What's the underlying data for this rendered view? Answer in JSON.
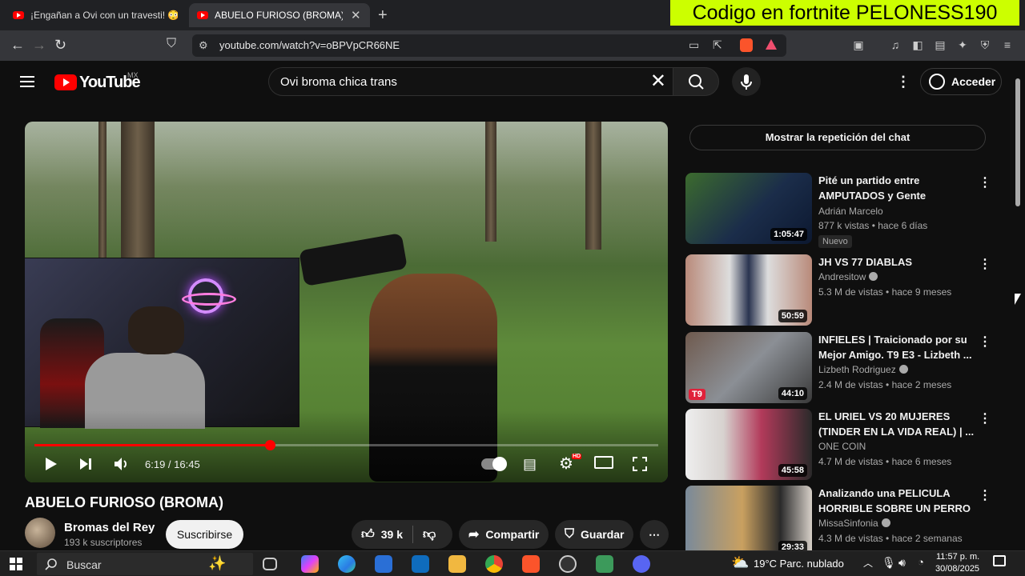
{
  "browser": {
    "tabs": [
      {
        "title": "¡Engañan a Ovi con un travesti! 😳 | L"
      },
      {
        "title": "ABUELO FURIOSO (BROMA) - Yo"
      }
    ],
    "url": "youtube.com/watch?v=oBPVpCR66NE",
    "overlay_banner": "Codigo en fortnite PELONESS190"
  },
  "header": {
    "logo_text": "YouTube",
    "country": "MX",
    "search_value": "Ovi broma chica trans",
    "signin_label": "Acceder"
  },
  "player": {
    "time_current": "6:19",
    "time_total": "16:45",
    "time_display": "6:19 / 16:45",
    "progress_fraction": 0.377,
    "quality_badge": "HD"
  },
  "video": {
    "title": "ABUELO FURIOSO (BROMA)",
    "channel": "Bromas del Rey",
    "subscribers": "193 k suscriptores",
    "subscribe_label": "Suscribirse",
    "likes": "39 k",
    "share_label": "Compartir",
    "save_label": "Guardar"
  },
  "sidebar": {
    "chat_replay": "Mostrar la repetición del chat",
    "recommendations": [
      {
        "title": "Pité un partido entre AMPUTADOS y Gente PEQUEÑ...",
        "channel": "Adrián Marcelo",
        "meta": "877 k vistas • hace 6 días",
        "duration": "1:05:47",
        "badge": "Nuevo",
        "verified": false
      },
      {
        "title": "JH VS 77 DIABLAS",
        "channel": "Andresitow",
        "meta": "5.3 M de vistas • hace 9 meses",
        "duration": "50:59",
        "badge": "",
        "verified": true
      },
      {
        "title": "INFIELES | Traicionado por su Mejor Amigo. T9 E3 - Lizbeth ...",
        "channel": "Lizbeth Rodriguez",
        "meta": "2.4 M de vistas • hace 2 meses",
        "duration": "44:10",
        "badge": "",
        "verified": true
      },
      {
        "title": "EL URIEL VS 20 MUJERES (TINDER EN LA VIDA REAL) | ...",
        "channel": "ONE COIN",
        "meta": "4.7 M de vistas • hace 6 meses",
        "duration": "45:58",
        "badge": "",
        "verified": false
      },
      {
        "title": "Analizando una PELICULA HORRIBLE SOBRE UN PERRO ...",
        "channel": "MissaSinfonia",
        "meta": "4.3 M de vistas • hace 2 semanas",
        "duration": "29:33",
        "badge": "",
        "verified": true
      }
    ]
  },
  "taskbar": {
    "search_placeholder": "Buscar",
    "weather": "19°C  Parc. nublado",
    "time": "11:57 p. m.",
    "date": "30/08/2025"
  }
}
